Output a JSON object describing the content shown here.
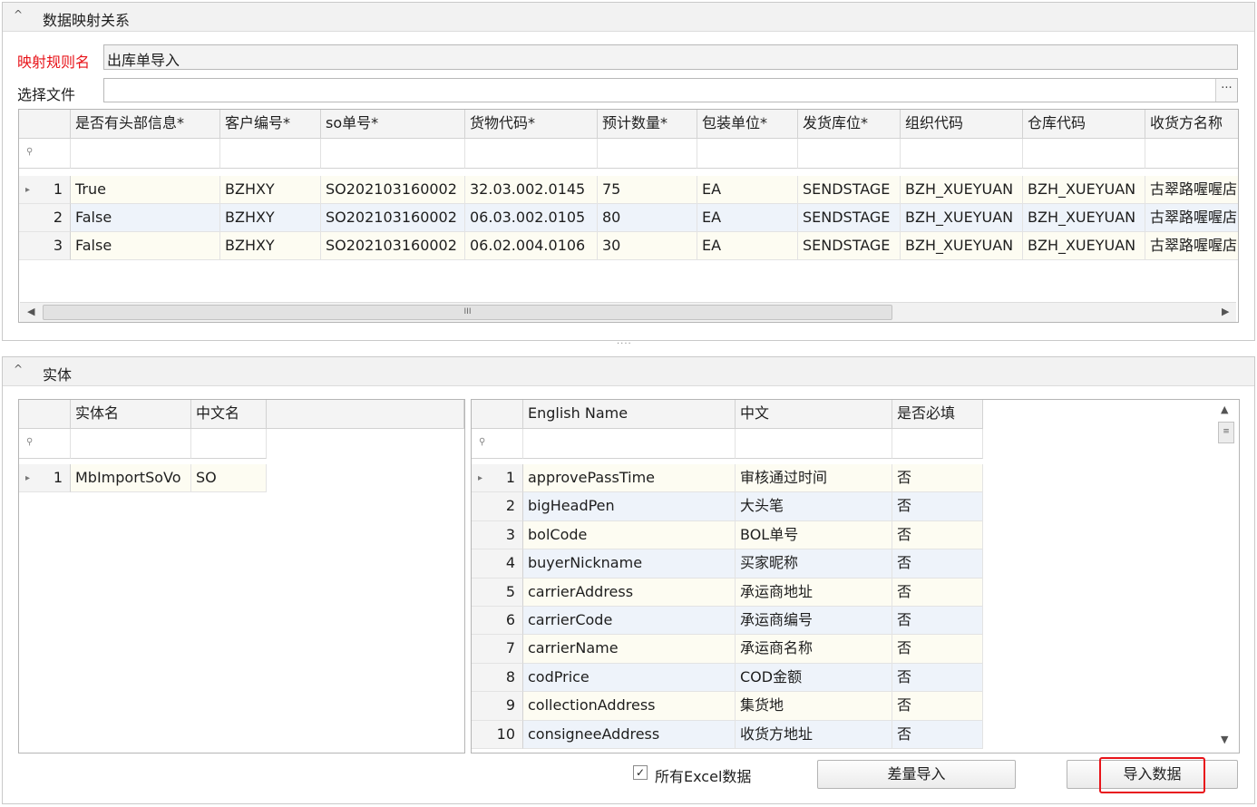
{
  "mapping_panel": {
    "title": "数据映射关系",
    "rule_name_label": "映射规则名",
    "rule_name_value": "出库单导入",
    "file_label": "选择文件",
    "file_value": "",
    "browse_label": "···",
    "grid": {
      "columns": [
        "是否有头部信息*",
        "客户编号*",
        "so单号*",
        "货物代码*",
        "预计数量*",
        "包装单位*",
        "发货库位*",
        "组织代码",
        "仓库代码",
        "收货方名称"
      ],
      "rows": [
        [
          "1",
          "True",
          "BZHXY",
          "SO202103160002",
          "32.03.002.0145",
          "75",
          "EA",
          "SENDSTAGE",
          "BZH_XUEYUAN",
          "BZH_XUEYUAN",
          "古翠路喔喔店"
        ],
        [
          "2",
          "False",
          "BZHXY",
          "SO202103160002",
          "06.03.002.0105",
          "80",
          "EA",
          "SENDSTAGE",
          "BZH_XUEYUAN",
          "BZH_XUEYUAN",
          "古翠路喔喔店"
        ],
        [
          "3",
          "False",
          "BZHXY",
          "SO202103160002",
          "06.02.004.0106",
          "30",
          "EA",
          "SENDSTAGE",
          "BZH_XUEYUAN",
          "BZH_XUEYUAN",
          "古翠路喔喔店"
        ]
      ]
    }
  },
  "splitter_label": "····",
  "entity_panel": {
    "title": "实体",
    "entity_grid": {
      "columns": [
        "实体名",
        "中文名"
      ],
      "rows": [
        [
          "1",
          "MbImportSoVo",
          "SO"
        ]
      ]
    },
    "field_grid": {
      "columns": [
        "English Name",
        "中文",
        "是否必填"
      ],
      "rows": [
        [
          "1",
          "approvePassTime",
          "审核通过时间",
          "否"
        ],
        [
          "2",
          "bigHeadPen",
          "大头笔",
          "否"
        ],
        [
          "3",
          "bolCode",
          "BOL单号",
          "否"
        ],
        [
          "4",
          "buyerNickname",
          "买家昵称",
          "否"
        ],
        [
          "5",
          "carrierAddress",
          "承运商地址",
          "否"
        ],
        [
          "6",
          "carrierCode",
          "承运商编号",
          "否"
        ],
        [
          "7",
          "carrierName",
          "承运商名称",
          "否"
        ],
        [
          "8",
          "codPrice",
          "COD金额",
          "否"
        ],
        [
          "9",
          "collectionAddress",
          "集货地",
          "否"
        ],
        [
          "10",
          "consigneeAddress",
          "收货方地址",
          "否"
        ]
      ]
    },
    "all_excel_checkbox": {
      "label": "所有Excel数据",
      "checked": true
    },
    "diff_import_label": "差量导入",
    "import_label": "导入数据"
  },
  "colors": {
    "required_label": "#e8141a",
    "highlight_border": "#e8141a",
    "alt_row": "#eef3fa"
  },
  "icons": [
    "collapse-caret-icon",
    "filter-pin-icon",
    "row-indicator-icon",
    "scroll-left-icon",
    "scroll-right-icon",
    "scroll-up-icon",
    "scroll-down-icon",
    "checkbox-checked-icon"
  ]
}
